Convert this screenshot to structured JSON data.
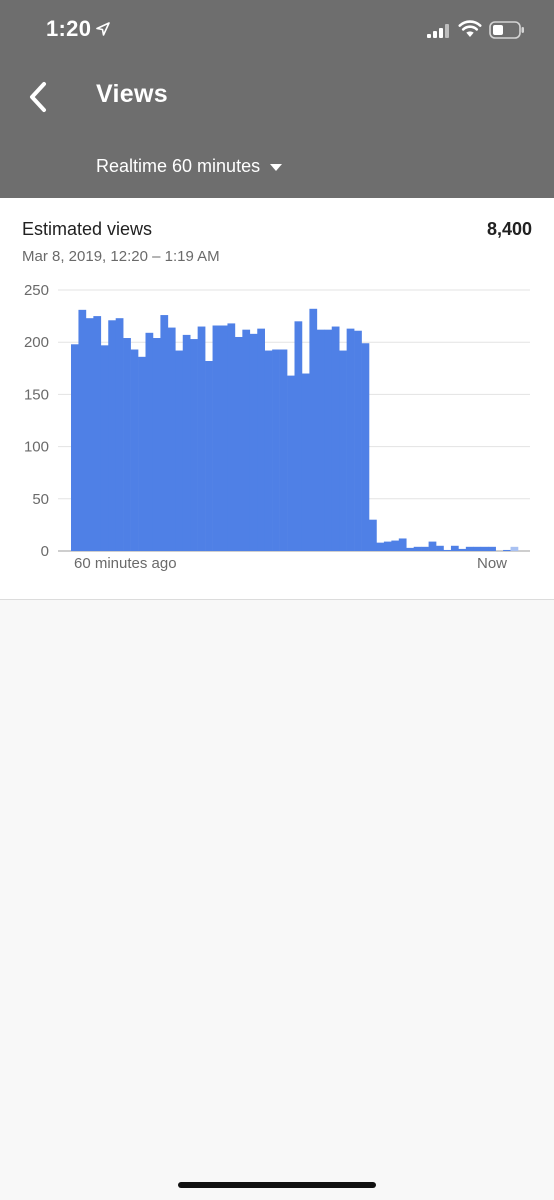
{
  "status_bar": {
    "time": "1:20",
    "icons": [
      "location-arrow-icon",
      "cellular-signal-icon",
      "wifi-icon",
      "battery-icon"
    ]
  },
  "header": {
    "title": "Views",
    "range_selector": "Realtime 60 minutes",
    "background_color": "#6e6e6e"
  },
  "card": {
    "metric_name": "Estimated views",
    "metric_value": "8,400",
    "date_range": "Mar 8, 2019, 12:20 – 1:19 AM"
  },
  "chart_data": {
    "type": "bar",
    "title": "",
    "xlabel": "",
    "ylabel": "",
    "ylim": [
      0,
      250
    ],
    "yticks": [
      0,
      50,
      100,
      150,
      200,
      250
    ],
    "x_axis_labels": [
      "60 minutes ago",
      "Now"
    ],
    "grid": true,
    "bar_color": "#4f80e6",
    "partial_bar_color": "#a9c1f2",
    "values": [
      198,
      231,
      223,
      225,
      197,
      221,
      223,
      204,
      193,
      186,
      209,
      204,
      226,
      214,
      192,
      207,
      203,
      215,
      182,
      216,
      216,
      218,
      205,
      212,
      208,
      213,
      192,
      193,
      193,
      168,
      220,
      170,
      232,
      212,
      212,
      215,
      192,
      213,
      211,
      199,
      30,
      8,
      9,
      10,
      12,
      3,
      4,
      4,
      9,
      5,
      1,
      5,
      2,
      4,
      4,
      4,
      4,
      0,
      1,
      4
    ]
  }
}
